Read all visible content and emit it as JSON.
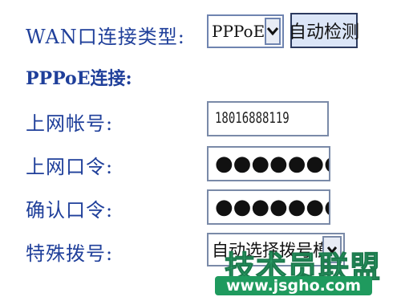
{
  "wan": {
    "label": "WAN口连接类型:",
    "type_value": "PPPoE",
    "detect_button": "自动检测"
  },
  "pppoe": {
    "section_title": "PPPoE连接:",
    "account_label": "上网帐号:",
    "account_value": "18016888119",
    "password_label": "上网口令:",
    "password_value": "●●●●●●●●●●●●●",
    "confirm_label": "确认口令:",
    "confirm_value": "●●●●●●●●●●●●●",
    "dial_label": "特殊拨号:",
    "dial_value": "自动选择拨号模式"
  },
  "watermark": {
    "brand": "技术员联盟",
    "url": "www.jsgho.com"
  },
  "colors": {
    "label_blue": "#1f3f9a",
    "watermark_green": "#2fa36b"
  },
  "icons": {
    "select_arrow": "chevron-down-icon"
  }
}
